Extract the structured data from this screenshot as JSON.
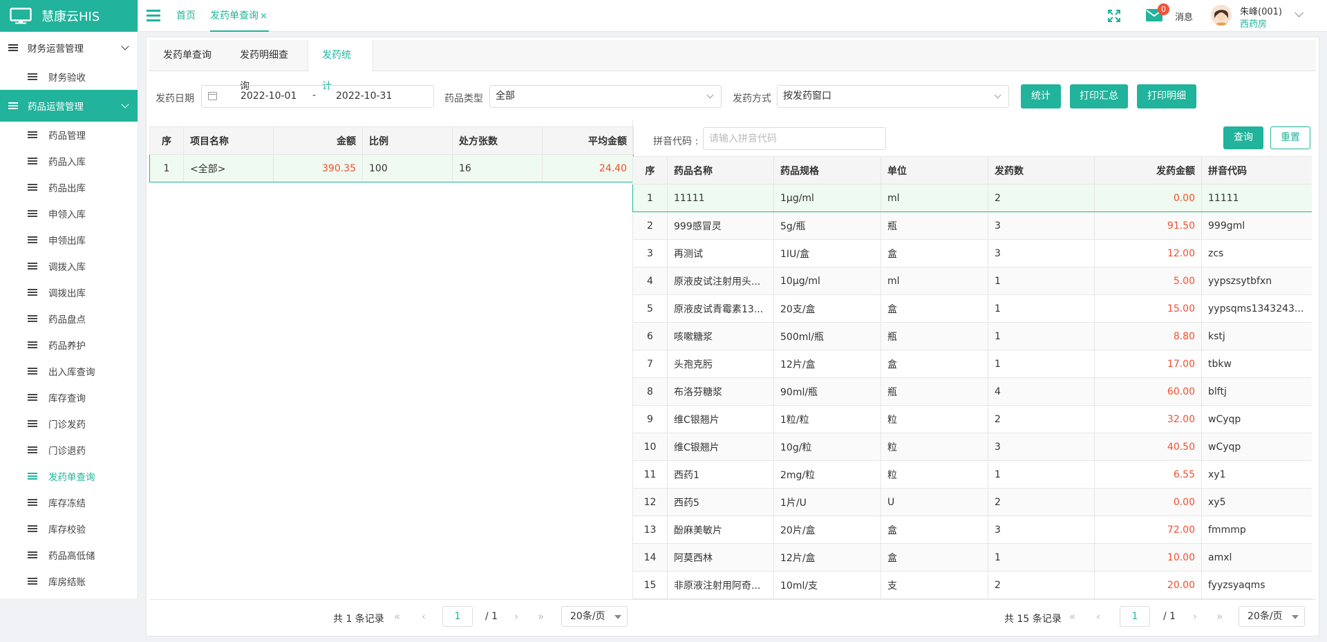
{
  "app": {
    "title": "慧康云HIS"
  },
  "sidebar": {
    "group1": {
      "label": "财务运营管理",
      "items": [
        {
          "label": "财务验收"
        }
      ]
    },
    "group2": {
      "label": "药品运营管理",
      "items": [
        {
          "label": "药品管理"
        },
        {
          "label": "药品入库"
        },
        {
          "label": "药品出库"
        },
        {
          "label": "申领入库"
        },
        {
          "label": "申领出库"
        },
        {
          "label": "调拨入库"
        },
        {
          "label": "调拨出库"
        },
        {
          "label": "药品盘点"
        },
        {
          "label": "药品养护"
        },
        {
          "label": "出入库查询"
        },
        {
          "label": "库存查询"
        },
        {
          "label": "门诊发药"
        },
        {
          "label": "门诊退药"
        },
        {
          "label": "发药单查询"
        },
        {
          "label": "库存冻结"
        },
        {
          "label": "库存校验"
        },
        {
          "label": "药品高低储"
        },
        {
          "label": "库房结账"
        }
      ]
    }
  },
  "header": {
    "tabs": [
      {
        "label": "首页"
      },
      {
        "label": "发药单查询"
      }
    ],
    "close_glyph": "×",
    "message_badge": "0",
    "message_label": "消息",
    "user_name": "朱峰(001)",
    "user_dept": "西药房"
  },
  "subtabs": [
    {
      "label": "发药单查询"
    },
    {
      "label": "发药明细查询"
    },
    {
      "label": "发药统计"
    }
  ],
  "filters": {
    "date_label": "发药日期",
    "date_start": "2022-10-01",
    "date_sep": "-",
    "date_end": "2022-10-31",
    "drug_type_label": "药品类型",
    "drug_type_value": "全部",
    "method_label": "发药方式",
    "method_value": "按发药窗口",
    "btn_stat": "统计",
    "btn_print_summary": "打印汇总",
    "btn_print_detail": "打印明细"
  },
  "left_table": {
    "headers": [
      "序",
      "项目名称",
      "金额",
      "比例",
      "处方张数",
      "平均金额"
    ],
    "rows": [
      [
        "1",
        "<全部>",
        "390.35",
        "100",
        "16",
        "24.40"
      ]
    ]
  },
  "right_search": {
    "label": "拼音代码 :",
    "placeholder": "请输入拼音代码",
    "btn_query": "查询",
    "btn_reset": "重置"
  },
  "right_table": {
    "headers": [
      "序",
      "药品名称",
      "药品规格",
      "单位",
      "发药数",
      "发药金额",
      "拼音代码"
    ],
    "rows": [
      [
        "1",
        "11111",
        "1μg/ml",
        "ml",
        "2",
        "0.00",
        "11111"
      ],
      [
        "2",
        "999感冒灵",
        "5g/瓶",
        "瓶",
        "3",
        "91.50",
        "999gml"
      ],
      [
        "3",
        "再测试",
        "1IU/盒",
        "盒",
        "3",
        "12.00",
        "zcs"
      ],
      [
        "4",
        "原液皮试注射用头...",
        "10μg/ml",
        "ml",
        "1",
        "5.00",
        "yypszsytbfxn"
      ],
      [
        "5",
        "原液皮试青霉素13...",
        "20支/盒",
        "盒",
        "1",
        "15.00",
        "yypsqms1343243..."
      ],
      [
        "6",
        "咳嗽糖浆",
        "500ml/瓶",
        "瓶",
        "1",
        "8.80",
        "kstj"
      ],
      [
        "7",
        "头孢克肟",
        "12片/盒",
        "盒",
        "1",
        "17.00",
        "tbkw"
      ],
      [
        "8",
        "布洛芬糖浆",
        "90ml/瓶",
        "瓶",
        "4",
        "60.00",
        "blftj"
      ],
      [
        "9",
        "维C银翘片",
        "1粒/粒",
        "粒",
        "2",
        "32.00",
        "wCyqp"
      ],
      [
        "10",
        "维C银翘片",
        "10g/粒",
        "粒",
        "3",
        "40.50",
        "wCyqp"
      ],
      [
        "11",
        "西药1",
        "2mg/粒",
        "粒",
        "1",
        "6.55",
        "xy1"
      ],
      [
        "12",
        "西药5",
        "1片/U",
        "U",
        "2",
        "0.00",
        "xy5"
      ],
      [
        "13",
        "酚麻美敏片",
        "20片/盒",
        "盒",
        "3",
        "72.00",
        "fmmmp"
      ],
      [
        "14",
        "阿莫西林",
        "12片/盒",
        "盒",
        "1",
        "10.00",
        "amxl"
      ],
      [
        "15",
        "非原液注射用阿奇...",
        "10ml/支",
        "支",
        "2",
        "20.00",
        "fyyzsyaqms"
      ]
    ]
  },
  "left_pager": {
    "total": "共 1 条记录",
    "page": "1",
    "of": "/ 1",
    "size": "20条/页"
  },
  "right_pager": {
    "total": "共 15 条记录",
    "page": "1",
    "of": "/ 1",
    "size": "20条/页"
  },
  "colors": {
    "accent": "#21b39b",
    "amount": "#f04f2f",
    "badge": "#f5523a"
  },
  "icons": [
    "monitor-icon",
    "menu-icon",
    "fullscreen-icon",
    "mail-icon",
    "calendar-icon",
    "chevron-down-icon",
    "first-page-icon",
    "prev-page-icon",
    "next-page-icon",
    "last-page-icon"
  ]
}
